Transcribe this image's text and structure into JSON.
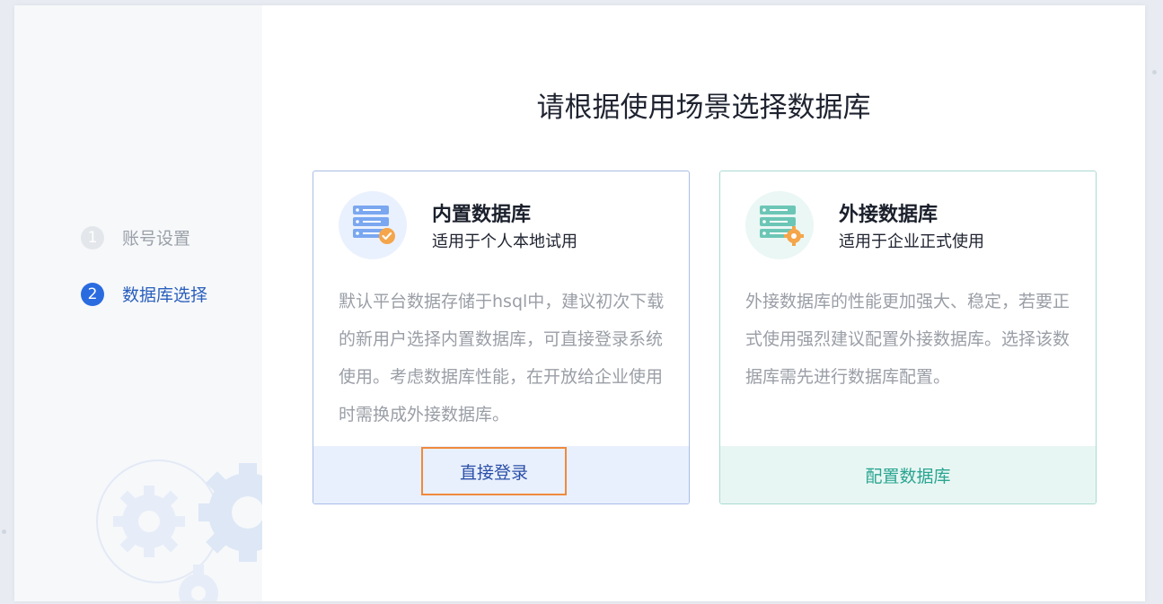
{
  "page": {
    "title": "请根据使用场景选择数据库"
  },
  "steps": [
    {
      "number": "1",
      "label": "账号设置",
      "state": "done"
    },
    {
      "number": "2",
      "label": "数据库选择",
      "state": "active"
    }
  ],
  "cards": {
    "builtin": {
      "title": "内置数据库",
      "subtitle": "适用于个人本地试用",
      "description": "默认平台数据存储于hsql中，建议初次下载的新用户选择内置数据库，可直接登录系统使用。考虑数据库性能，在开放给企业使用时需换成外接数据库。",
      "action": "直接登录",
      "icon": "server-check-icon"
    },
    "external": {
      "title": "外接数据库",
      "subtitle": "适用于企业正式使用",
      "description": "外接数据库的性能更加强大、稳定，若要正式使用强烈建议配置外接数据库。选择该数据库需先进行数据库配置。",
      "action": "配置数据库",
      "icon": "server-gear-icon"
    }
  },
  "colors": {
    "accent_blue": "#2a6ce0",
    "accent_teal": "#2aa591",
    "highlight_orange": "#f08a3c"
  }
}
